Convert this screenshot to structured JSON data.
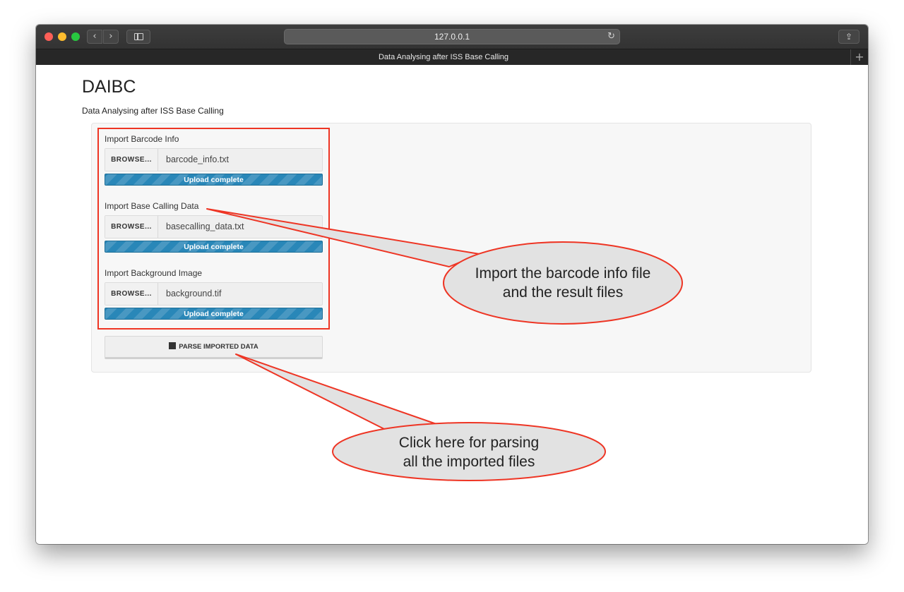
{
  "browser": {
    "url": "127.0.0.1",
    "tab_title": "Data Analysing after ISS Base Calling",
    "back_icon": "‹",
    "forward_icon": "›",
    "reload_icon": "↻",
    "share_icon": "⇪",
    "new_tab_icon": "+"
  },
  "app": {
    "title": "DAIBC",
    "subtitle": "Data Analysing after ISS Base Calling"
  },
  "imports": [
    {
      "label": "Import Barcode Info",
      "button": "BROWSE...",
      "file": "barcode_info.txt",
      "status": "Upload complete",
      "progress": 1.0
    },
    {
      "label": "Import Base Calling Data",
      "button": "BROWSE...",
      "file": "basecalling_data.txt",
      "status": "Upload complete",
      "progress": 1.0
    },
    {
      "label": "Import Background Image",
      "button": "BROWSE...",
      "file": "background.tif",
      "status": "Upload complete",
      "progress": 1.0
    }
  ],
  "parse_button": {
    "label": "PARSE IMPORTED DATA",
    "icon": "chip-icon"
  },
  "annotations": [
    {
      "text": "Import the barcode info file\nand the result files"
    },
    {
      "text": "Click here for parsing\nall the imported files"
    }
  ],
  "colors": {
    "highlight": "#ee3524",
    "callout_fill": "#e2e2e2",
    "progress": "#2b8dc0"
  }
}
